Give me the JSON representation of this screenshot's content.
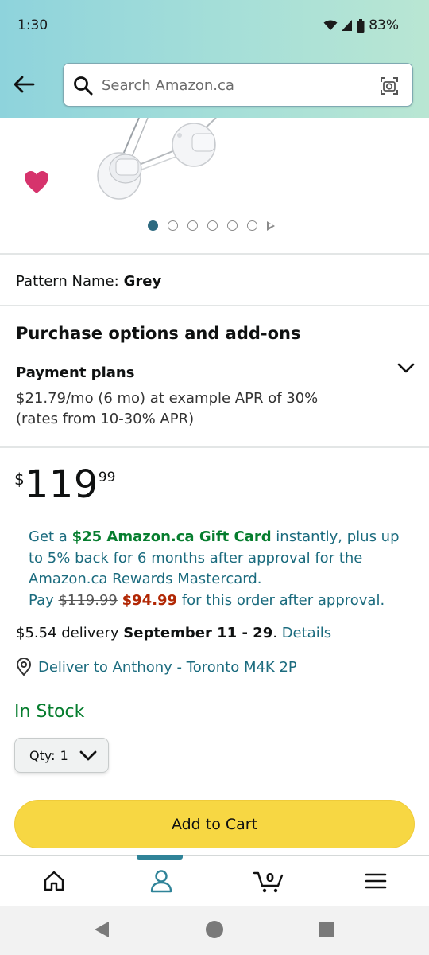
{
  "status_bar": {
    "time": "1:30",
    "battery": "83%"
  },
  "search": {
    "placeholder": "Search Amazon.ca"
  },
  "carousel": {
    "total_images": 6,
    "active_index": 0
  },
  "pattern": {
    "label": "Pattern Name:",
    "value": "Grey"
  },
  "purchase_options": {
    "title": "Purchase options and add-ons",
    "payment_plans_title": "Payment plans",
    "line1": "$21.79/mo (6 mo) at example APR of 30%",
    "line2": "(rates from 10-30% APR)"
  },
  "price": {
    "currency": "$",
    "whole": "119",
    "fraction": "99"
  },
  "offer": {
    "prefix": "Get a ",
    "gift_card": "$25 Amazon.ca Gift Card",
    "middle": " instantly, plus up to 5% back for 6 months after approval for the Amazon.ca Rewards Mastercard.",
    "pay_label": "Pay ",
    "old_price": "$119.99",
    "new_price": "$94.99",
    "suffix": " for this order after approval."
  },
  "delivery": {
    "prefix": "$5.54 delivery ",
    "dates": "September 11 - 29",
    "dot": ". ",
    "details_link": "Details",
    "deliver_to": "Deliver to Anthony - Toronto M4K 2P"
  },
  "stock": {
    "status": "In Stock"
  },
  "quantity": {
    "label": "Qty:",
    "value": "1"
  },
  "actions": {
    "add_to_cart": "Add to Cart"
  },
  "bottom_nav": {
    "cart_count": "0",
    "active": "account"
  },
  "colors": {
    "accent_teal": "#2f8398",
    "link_teal": "#1b6b7e",
    "in_stock_green": "#067d2e",
    "price_red": "#b12704",
    "add_to_cart_yellow": "#f7d743",
    "wishlist_pink": "#d6336c"
  },
  "icons": [
    "back-arrow-icon",
    "search-icon",
    "camera-icon",
    "heart-icon",
    "chevron-down-icon",
    "location-pin-icon",
    "home-icon",
    "account-icon",
    "cart-icon",
    "menu-icon"
  ]
}
